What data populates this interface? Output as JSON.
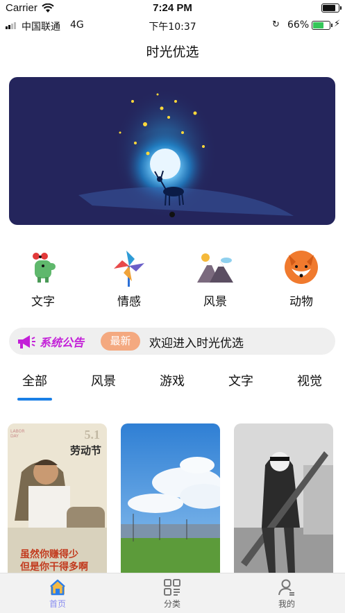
{
  "status_bar": {
    "carrier": "Carrier",
    "time": "7:24 PM"
  },
  "android_bar": {
    "carrier": "中国联通",
    "network": "4G",
    "time": "下午10:37",
    "battery_pct": "66%",
    "battery_level": 0.66
  },
  "nav": {
    "title": "时光优选"
  },
  "categories": [
    {
      "label": "文字",
      "icon": "dinosaur-icon"
    },
    {
      "label": "情感",
      "icon": "pinwheel-icon"
    },
    {
      "label": "风景",
      "icon": "mountain-icon"
    },
    {
      "label": "动物",
      "icon": "fox-icon"
    }
  ],
  "notice": {
    "title": "系统公告",
    "badge": "最新",
    "text": "欢迎进入时光优选",
    "title_color": "#c31fd8"
  },
  "tabs": {
    "items": [
      "全部",
      "风景",
      "游戏",
      "文字",
      "视觉"
    ],
    "active_index": 0,
    "accent": "#1a7fe6"
  },
  "cards": [
    {
      "name": "labor-day-poster",
      "texts": [
        "5.1",
        "劳动节",
        "LABOR DAY",
        "虽然你赚得少",
        "但是你干得多啊"
      ]
    },
    {
      "name": "sky-field-photo"
    },
    {
      "name": "warrior-girl-art"
    }
  ],
  "tabbar": {
    "items": [
      "首页",
      "分类",
      "我的"
    ],
    "active_index": 0,
    "active_color": "#8a8ef0"
  }
}
